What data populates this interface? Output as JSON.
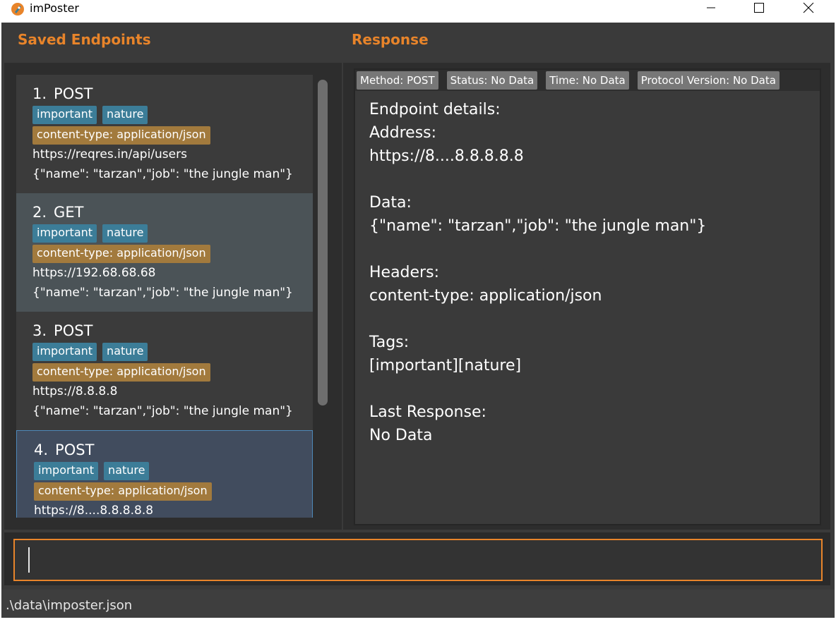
{
  "window": {
    "title": "imPoster"
  },
  "panels": {
    "saved_endpoints_title": "Saved Endpoints",
    "response_title": "Response"
  },
  "endpoints": [
    {
      "index": "1.",
      "method": "POST",
      "tags": [
        "important",
        "nature"
      ],
      "header": "content-type: application/json",
      "address": "https://reqres.in/api/users",
      "data": "{\"name\": \"tarzan\",\"job\": \"the jungle man\"}"
    },
    {
      "index": "2.",
      "method": "GET",
      "tags": [
        "important",
        "nature"
      ],
      "header": "content-type: application/json",
      "address": "https://192.68.68.68",
      "data": "{\"name\": \"tarzan\",\"job\": \"the jungle man\"}"
    },
    {
      "index": "3.",
      "method": "POST",
      "tags": [
        "important",
        "nature"
      ],
      "header": "content-type: application/json",
      "address": "https://8.8.8.8",
      "data": "{\"name\": \"tarzan\",\"job\": \"the jungle man\"}"
    },
    {
      "index": "4.",
      "method": "POST",
      "tags": [
        "important",
        "nature"
      ],
      "header": "content-type: application/json",
      "address": "https://8....8.8.8.8.8"
    }
  ],
  "response": {
    "badges": {
      "method": "Method: POST",
      "status": "Status: No Data",
      "time": "Time: No Data",
      "protocol": "Protocol Version: No Data"
    },
    "details": {
      "heading": "Endpoint details:",
      "address_label": "Address:",
      "address_value": "https://8....8.8.8.8.8",
      "data_label": "Data:",
      "data_value": "{\"name\": \"tarzan\",\"job\": \"the jungle man\"}",
      "headers_label": "Headers:",
      "headers_value": "content-type: application/json",
      "tags_label": "Tags:",
      "tags_value": "[important][nature]",
      "last_response_label": "Last Response:",
      "last_response_value": "No Data"
    }
  },
  "command": {
    "value": ""
  },
  "status_bar": {
    "path": ".\\data\\imposter.json"
  },
  "colors": {
    "accent": "#e8842a",
    "tag": "#3c7d98",
    "header_tag": "#a27a3d",
    "selected_item": "#414c5e"
  },
  "icons": {
    "app_logo": "rocket-logo-icon",
    "minimize": "minimize-icon",
    "maximize": "maximize-icon",
    "close": "close-icon"
  }
}
